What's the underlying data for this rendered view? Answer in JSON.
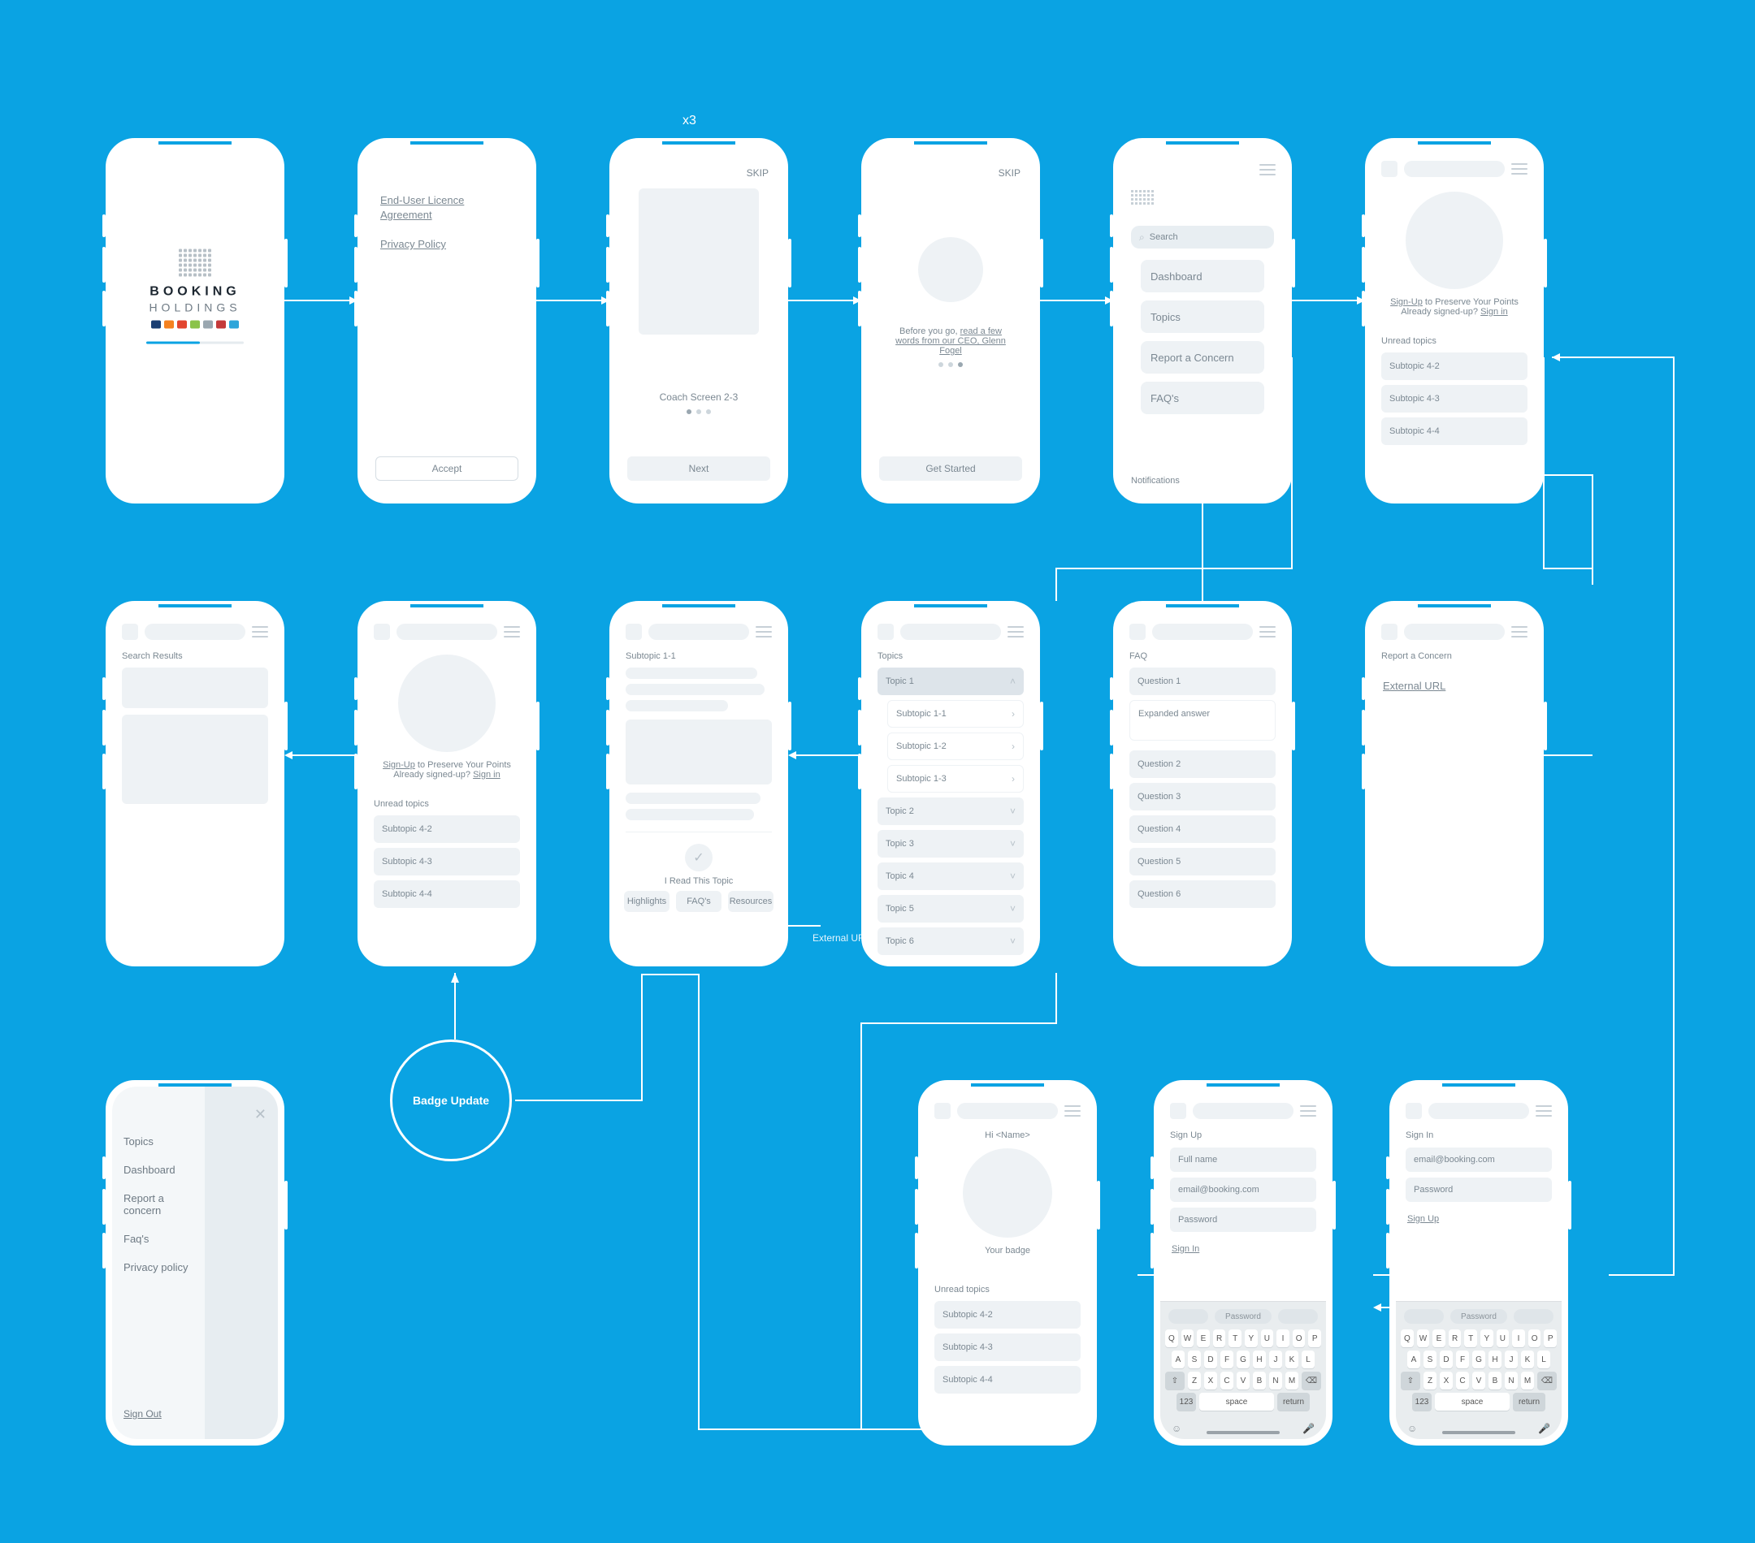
{
  "captions": {
    "x3": "x3",
    "external_url_small": "External URL"
  },
  "splash": {
    "brand_top": "BOOKING",
    "brand_bottom": "HOLDINGS"
  },
  "legal": {
    "eula": "End-User Licence Agreement",
    "privacy": "Privacy Policy",
    "accept": "Accept"
  },
  "coach": {
    "skip": "SKIP",
    "title": "Coach Screen 2-3",
    "next": "Next"
  },
  "ceo": {
    "skip": "SKIP",
    "text_a": "Before you go, ",
    "text_link": "read a few words from our CEO, Glenn Fogel",
    "get_started": "Get Started"
  },
  "home_menu": {
    "search_placeholder": "Search",
    "items": [
      "Dashboard",
      "Topics",
      "Report a Concern",
      "FAQ's"
    ],
    "notifications": "Notifications"
  },
  "dashboard": {
    "signup_prefix": "Sign-Up",
    "signup_rest": " to Preserve Your Points",
    "already": "Already signed-up?  ",
    "signin": "Sign in",
    "unread": "Unread topics",
    "items": [
      "Subtopic 4-2",
      "Subtopic 4-3",
      "Subtopic 4-4"
    ]
  },
  "search": {
    "title": "Search Results"
  },
  "article": {
    "title": "Subtopic 1-1",
    "read_btn": "I Read This Topic",
    "tabs": [
      "Highlights",
      "FAQ's",
      "Resources"
    ]
  },
  "topics": {
    "title": "Topics",
    "exp": "Topic 1",
    "subs": [
      "Subtopic 1-1",
      "Subtopic 1-2",
      "Subtopic 1-3"
    ],
    "rest": [
      "Topic 2",
      "Topic 3",
      "Topic 4",
      "Topic 5",
      "Topic 6"
    ]
  },
  "faq": {
    "title": "FAQ",
    "q1": "Question 1",
    "a1": "Expanded answer",
    "rest": [
      "Question 2",
      "Question 3",
      "Question 4",
      "Question 5",
      "Question 6"
    ]
  },
  "report": {
    "title": "Report a Concern",
    "link": "External URL"
  },
  "badge_node": "Badge Update",
  "drawer": {
    "items": [
      "Topics",
      "Dashboard",
      "Report a concern",
      "Faq's",
      "Privacy policy"
    ],
    "signout": "Sign Out"
  },
  "profile": {
    "hello": "Hi <Name>",
    "your_badge": "Your badge",
    "unread": "Unread topics",
    "items": [
      "Subtopic 4-2",
      "Subtopic 4-3",
      "Subtopic 4-4"
    ]
  },
  "signup": {
    "title": "Sign Up",
    "fullname": "Full name",
    "email": "email@booking.com",
    "password": "Password",
    "signin_link": "Sign In"
  },
  "signin": {
    "title": "Sign In",
    "email": "email@booking.com",
    "password": "Password",
    "signup_link": "Sign Up"
  },
  "keyboard": {
    "pred_mid": "Password",
    "rows": [
      [
        "Q",
        "W",
        "E",
        "R",
        "T",
        "Y",
        "U",
        "I",
        "O",
        "P"
      ],
      [
        "A",
        "S",
        "D",
        "F",
        "G",
        "H",
        "J",
        "K",
        "L"
      ],
      [
        "⇧",
        "Z",
        "X",
        "C",
        "V",
        "B",
        "N",
        "M",
        "⌫"
      ]
    ],
    "num": "123",
    "space": "space",
    "ret": "return"
  }
}
